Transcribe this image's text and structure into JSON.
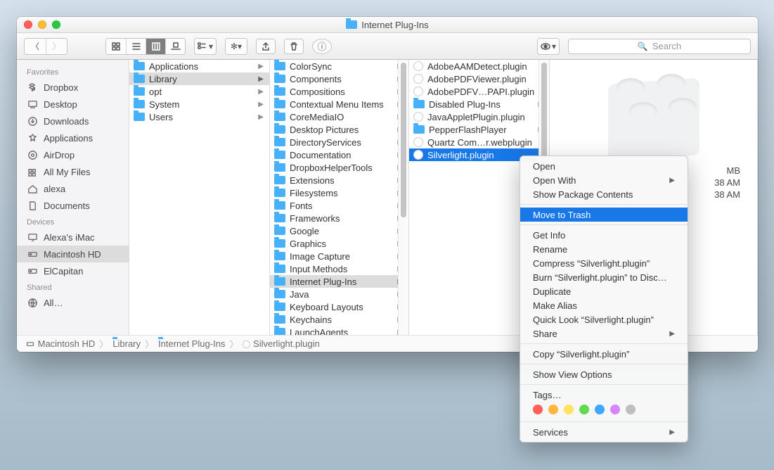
{
  "window": {
    "title": "Internet Plug-Ins"
  },
  "toolbar": {
    "searchPlaceholder": "Search"
  },
  "sidebar": {
    "sections": [
      {
        "title": "Favorites",
        "items": [
          {
            "icon": "dropbox",
            "label": "Dropbox"
          },
          {
            "icon": "desktop",
            "label": "Desktop"
          },
          {
            "icon": "download",
            "label": "Downloads"
          },
          {
            "icon": "apps",
            "label": "Applications"
          },
          {
            "icon": "airdrop",
            "label": "AirDrop"
          },
          {
            "icon": "allfiles",
            "label": "All My Files"
          },
          {
            "icon": "home",
            "label": "alexa"
          },
          {
            "icon": "docs",
            "label": "Documents"
          }
        ]
      },
      {
        "title": "Devices",
        "items": [
          {
            "icon": "imac",
            "label": "Alexa's iMac"
          },
          {
            "icon": "hd",
            "label": "Macintosh HD",
            "selected": true
          },
          {
            "icon": "hd",
            "label": "ElCapitan"
          }
        ]
      },
      {
        "title": "Shared",
        "items": [
          {
            "icon": "globe",
            "label": "All…"
          }
        ]
      }
    ]
  },
  "columns": {
    "c1": [
      {
        "label": "Applications",
        "folder": true,
        "arrow": true
      },
      {
        "label": "Library",
        "folder": true,
        "arrow": true,
        "selected": true
      },
      {
        "label": "opt",
        "folder": true,
        "arrow": true
      },
      {
        "label": "System",
        "folder": true,
        "arrow": true
      },
      {
        "label": "Users",
        "folder": true,
        "arrow": true
      }
    ],
    "c2": [
      {
        "label": "ColorSync",
        "folder": true,
        "arrow": true
      },
      {
        "label": "Components",
        "folder": true,
        "arrow": true
      },
      {
        "label": "Compositions",
        "folder": true,
        "arrow": true
      },
      {
        "label": "Contextual Menu Items",
        "folder": true,
        "arrow": true
      },
      {
        "label": "CoreMediaIO",
        "folder": true,
        "arrow": true
      },
      {
        "label": "Desktop Pictures",
        "folder": true,
        "arrow": true
      },
      {
        "label": "DirectoryServices",
        "folder": true,
        "arrow": true
      },
      {
        "label": "Documentation",
        "folder": true,
        "arrow": true
      },
      {
        "label": "DropboxHelperTools",
        "folder": true,
        "arrow": true
      },
      {
        "label": "Extensions",
        "folder": true,
        "arrow": true
      },
      {
        "label": "Filesystems",
        "folder": true,
        "arrow": true
      },
      {
        "label": "Fonts",
        "folder": true,
        "arrow": true
      },
      {
        "label": "Frameworks",
        "folder": true,
        "arrow": true
      },
      {
        "label": "Google",
        "folder": true,
        "arrow": true
      },
      {
        "label": "Graphics",
        "folder": true,
        "arrow": true
      },
      {
        "label": "Image Capture",
        "folder": true,
        "arrow": true
      },
      {
        "label": "Input Methods",
        "folder": true,
        "arrow": true
      },
      {
        "label": "Internet Plug-Ins",
        "folder": true,
        "arrow": true,
        "selected": true
      },
      {
        "label": "Java",
        "folder": true,
        "arrow": true
      },
      {
        "label": "Keyboard Layouts",
        "folder": true,
        "arrow": true
      },
      {
        "label": "Keychains",
        "folder": true,
        "arrow": true
      },
      {
        "label": "LaunchAgents",
        "folder": true,
        "arrow": true
      }
    ],
    "c3": [
      {
        "label": "AdobeAAMDetect.plugin",
        "plugin": true
      },
      {
        "label": "AdobePDFViewer.plugin",
        "plugin": true
      },
      {
        "label": "AdobePDFV…PAPI.plugin",
        "plugin": true
      },
      {
        "label": "Disabled Plug-Ins",
        "folder": true,
        "arrow": true
      },
      {
        "label": "JavaAppletPlugin.plugin",
        "plugin": true
      },
      {
        "label": "PepperFlashPlayer",
        "folder": true,
        "arrow": true
      },
      {
        "label": "Quartz Com…r.webplugin",
        "plugin": true
      },
      {
        "label": "Silverlight.plugin",
        "plugin": true,
        "hilite": true
      }
    ]
  },
  "selectedInfo": {
    "name": "Silverlight.plugin",
    "sizeSuffix": "MB",
    "createdTime": "38 AM",
    "modifiedTime": "38 AM"
  },
  "pathbar": [
    "Macintosh HD",
    "Library",
    "Internet Plug-Ins",
    "Silverlight.plugin"
  ],
  "contextMenu": {
    "groups": [
      [
        {
          "label": "Open"
        },
        {
          "label": "Open With",
          "submenu": true
        },
        {
          "label": "Show Package Contents"
        }
      ],
      [
        {
          "label": "Move to Trash",
          "selected": true
        }
      ],
      [
        {
          "label": "Get Info"
        },
        {
          "label": "Rename"
        },
        {
          "label": "Compress “Silverlight.plugin”"
        },
        {
          "label": "Burn “Silverlight.plugin” to Disc…"
        },
        {
          "label": "Duplicate"
        },
        {
          "label": "Make Alias"
        },
        {
          "label": "Quick Look “Silverlight.plugin”"
        },
        {
          "label": "Share",
          "submenu": true
        }
      ],
      [
        {
          "label": "Copy “Silverlight.plugin”"
        }
      ],
      [
        {
          "label": "Show View Options"
        }
      ],
      [
        {
          "label": "Tags…"
        }
      ],
      [
        {
          "label": "Services",
          "submenu": true
        }
      ]
    ],
    "tagColors": [
      "#ff5f57",
      "#ffb53e",
      "#ffe260",
      "#62d94e",
      "#3fa7ff",
      "#d785ff",
      "#bfbfbf"
    ]
  }
}
